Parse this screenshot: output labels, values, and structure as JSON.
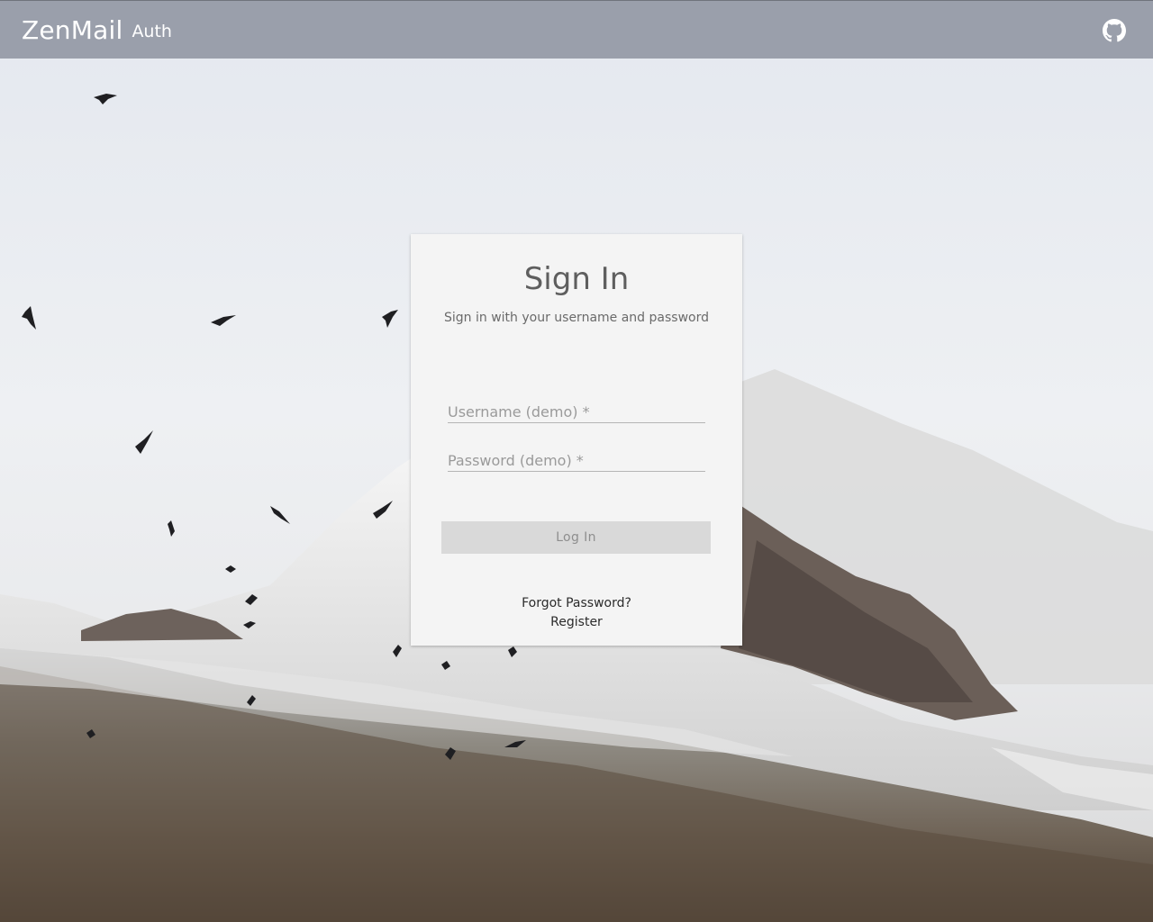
{
  "header": {
    "brand": "ZenMail",
    "subtitle": "Auth",
    "github_icon": "github-icon"
  },
  "signin": {
    "title": "Sign In",
    "subtitle": "Sign in with your username and password",
    "username_placeholder": "Username (demo) *",
    "password_placeholder": "Password (demo) *",
    "login_label": "Log In",
    "forgot_label": "Forgot Password?",
    "register_label": "Register"
  },
  "colors": {
    "appbar": "#9a9fab",
    "card": "#f4f4f4",
    "button_disabled": "#d9d9d9"
  },
  "background_image": "snowy mountain with flying birds"
}
